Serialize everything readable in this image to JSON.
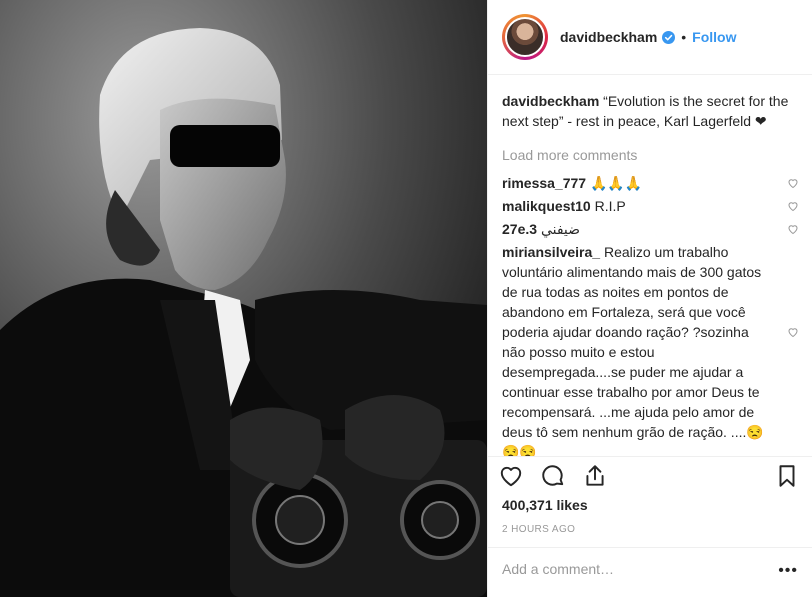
{
  "post": {
    "username": "davidbeckham",
    "follow_label": "Follow",
    "separator": "•",
    "caption": "“Evolution is the secret for the next step” - rest in peace, Karl Lagerfeld ❤",
    "load_more": "Load more comments"
  },
  "comments": [
    {
      "user": "rimessa_777",
      "text": "🙏🙏🙏"
    },
    {
      "user": "malikquest10",
      "text": "R.I.P"
    },
    {
      "user": "27e.3",
      "text": "ضيفني"
    },
    {
      "user": "miriansilveira_",
      "text": "Realizo um trabalho voluntário alimentando mais de 300 gatos de rua todas as noites em pontos de abandono em Fortaleza, será que você poderia ajudar doando ração? ?sozinha não posso muito e estou desempregada....se puder me ajudar a continuar esse trabalho por amor Deus te recompensará. ...me ajuda pelo amor de deus tô sem nenhum grão de ração. ....😒😒😒"
    }
  ],
  "likes": "400,371 likes",
  "time_ago": "2 HOURS AGO",
  "add_comment": {
    "placeholder": "Add a comment…",
    "more": "•••"
  },
  "icons": {
    "verified": "verified-badge-icon",
    "like": "heart-outline-icon",
    "comment": "comment-bubble-icon",
    "share": "share-icon",
    "save": "bookmark-icon"
  },
  "colors": {
    "accent": "#3897f0",
    "muted": "#999999",
    "text": "#262626",
    "border": "#efefef"
  }
}
